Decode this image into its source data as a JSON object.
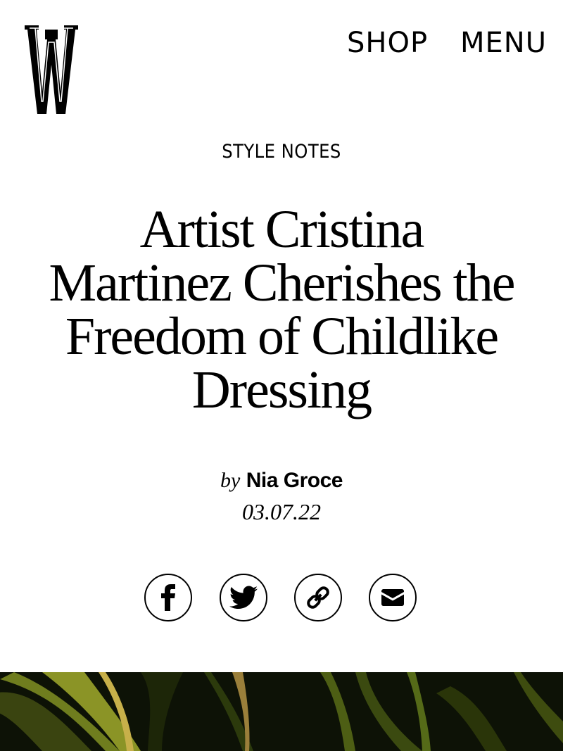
{
  "header": {
    "logo_alt": "W",
    "shop_label": "SHOP",
    "menu_label": "MENU"
  },
  "article": {
    "category": "STYLE NOTES",
    "title_lines": [
      "Artist Cristina",
      "Martinez Cherishes the",
      "Freedom of Childlike",
      "Dressing"
    ],
    "byline_prefix": "by",
    "author": "Nia Groce",
    "date": "03.07.22"
  },
  "share": {
    "icons": [
      "facebook-icon",
      "twitter-icon",
      "link-icon",
      "email-icon"
    ]
  },
  "colors": {
    "text": "#000000",
    "background": "#ffffff",
    "hero_dark": "#0d1206",
    "hero_leaf": "#6f7d1e"
  }
}
